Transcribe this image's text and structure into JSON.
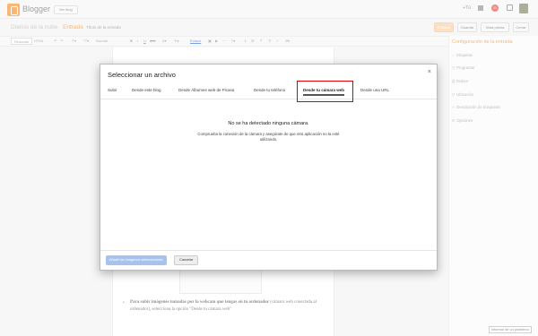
{
  "header": {
    "brand": "Blogger",
    "view_blog": "Ver blog",
    "plus_user": "+Tú",
    "notification_count": "11",
    "accent_color": "#f57d00"
  },
  "titlebar": {
    "blog_name": "Diarios de la nube",
    "separator": "·",
    "post_label": "Entrada",
    "title_placeholder": "Título de la entrada",
    "publish": "Publicar",
    "save": "Guardar",
    "preview": "Vista previa",
    "close": "Cerrar"
  },
  "toolbar": {
    "compose": "Redactar",
    "html": "HTML",
    "font_size": "Normal",
    "link": "Enlace"
  },
  "sidebar": {
    "title": "Configuración de la entrada",
    "items": [
      {
        "label": "Etiquetas",
        "icon": "tag-icon"
      },
      {
        "label": "Programar",
        "icon": "clock-icon"
      },
      {
        "label": "Enlace",
        "icon": "link-icon"
      },
      {
        "label": "Ubicación",
        "icon": "location-icon"
      },
      {
        "label": "Descripción de búsqueda",
        "icon": "search-icon"
      },
      {
        "label": "Opciones",
        "icon": "gear-icon"
      }
    ],
    "report": "Informar de un problema"
  },
  "editor": {
    "body_text_strong": "Para subir imágenes tomadas por la webcam que tengas en tu ordenador",
    "body_text_rest": " (cámara web conectada al ordenador), selecciona la opción \"Desde tu cámara web\""
  },
  "dialog": {
    "title": "Seleccionar un archivo",
    "tabs": [
      {
        "label": "Subir"
      },
      {
        "label": "Desde este blog"
      },
      {
        "label": "Desde Álbumes web de Picasa"
      },
      {
        "label": "Desde tu teléfono"
      },
      {
        "label": "Desde tu cámara web",
        "active": true
      },
      {
        "label": "Desde una URL"
      }
    ],
    "message": "No se ha detectado ninguna cámara.",
    "submessage": "Comprueba la conexión de la cámara y asegúrate de que otra aplicación no la esté utilizando.",
    "add_selected": "Añadir las imágenes seleccionadas",
    "cancel": "Cancelar",
    "highlight_color": "#dd0000"
  }
}
